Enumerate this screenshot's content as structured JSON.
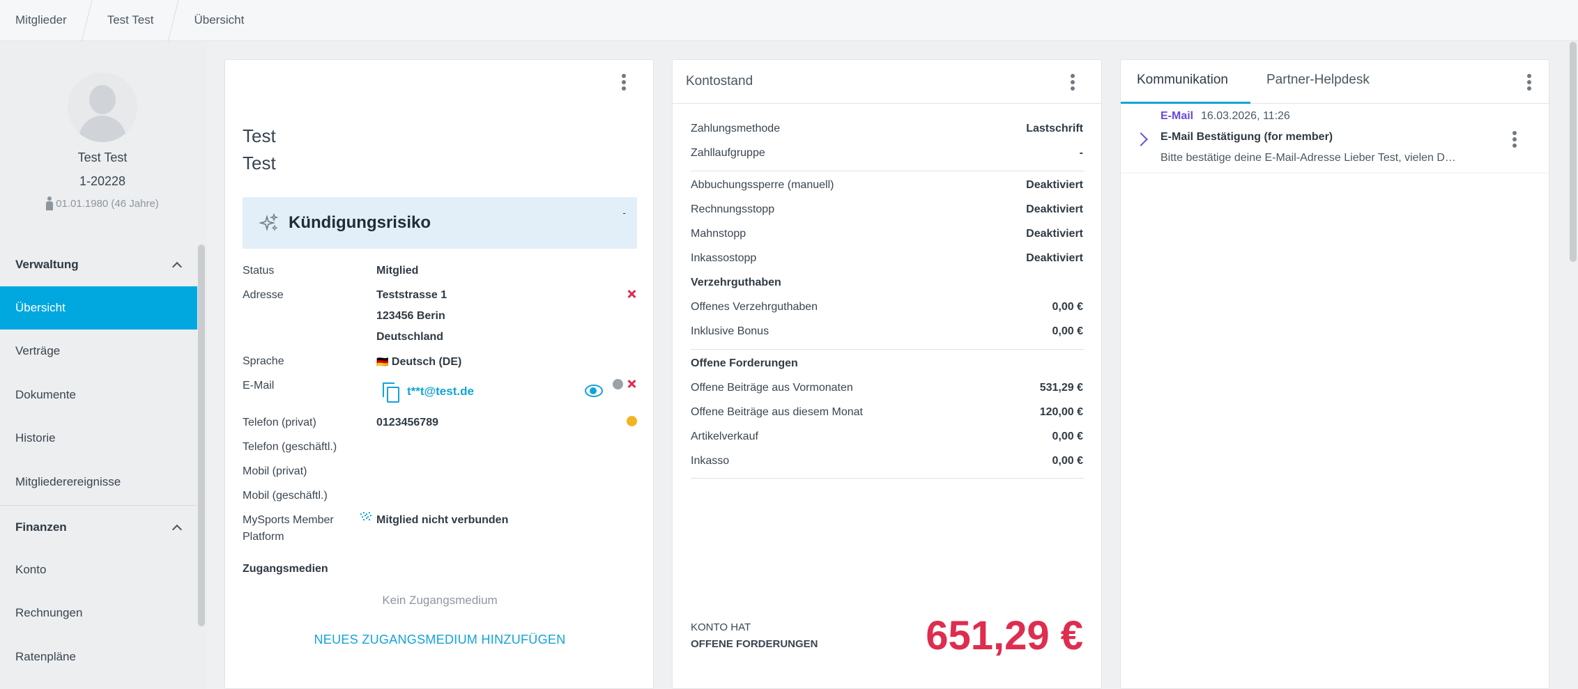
{
  "breadcrumb": [
    "Mitglieder",
    "Test Test",
    "Übersicht"
  ],
  "profile": {
    "name": "Test Test",
    "number": "1-20228",
    "dob": "01.01.1980 (46 Jahre)"
  },
  "sidebar": {
    "sections": [
      {
        "label": "Verwaltung",
        "items": [
          "Übersicht",
          "Verträge",
          "Dokumente",
          "Historie",
          "Mitgliederereignisse"
        ]
      },
      {
        "label": "Finanzen",
        "items": [
          "Konto",
          "Rechnungen",
          "Ratenpläne"
        ]
      }
    ],
    "active": "Übersicht"
  },
  "member_card": {
    "first_name": "Test",
    "last_name": "Test",
    "risk_title": "Kündigungsrisiko",
    "risk_value": "-",
    "rows": {
      "status_label": "Status",
      "status_value": "Mitglied",
      "address_label": "Adresse",
      "address_line1": "Teststrasse 1",
      "address_line2": "123456 Berin",
      "address_line3": "Deutschland",
      "language_label": "Sprache",
      "language_flag": "🇩🇪",
      "language_value": "Deutsch (DE)",
      "email_label": "E-Mail",
      "email_value": "t**t@test.de",
      "phone_private_label": "Telefon (privat)",
      "phone_private_value": "0123456789",
      "phone_business_label": "Telefon (geschäftl.)",
      "mobile_private_label": "Mobil (privat)",
      "mobile_business_label": "Mobil (geschäftl.)",
      "mysports_label_1": "MySports Member",
      "mysports_label_2": "Platform",
      "mysports_value": "Mitglied nicht verbunden"
    },
    "access_title": "Zugangsmedien",
    "access_empty": "Kein Zugangsmedium",
    "access_add": "NEUES ZUGANGSMEDIUM HINZUFÜGEN"
  },
  "account_card": {
    "title": "Kontostand",
    "group1": [
      {
        "label": "Zahlungsmethode",
        "value": "Lastschrift"
      },
      {
        "label": "Zahllaufgruppe",
        "value": "-"
      }
    ],
    "group2": [
      {
        "label": "Abbuchungssperre (manuell)",
        "value": "Deaktiviert"
      },
      {
        "label": "Rechnungsstopp",
        "value": "Deaktiviert"
      },
      {
        "label": "Mahnstopp",
        "value": "Deaktiviert"
      },
      {
        "label": "Inkassostopp",
        "value": "Deaktiviert"
      }
    ],
    "group3_title": "Verzehrguthaben",
    "group3": [
      {
        "label": "Offenes Verzehrguthaben",
        "value": "0,00 €"
      },
      {
        "label": "Inklusive Bonus",
        "value": "0,00 €"
      }
    ],
    "group4_title": "Offene Forderungen",
    "group4": [
      {
        "label": "Offene Beiträge aus Vormonaten",
        "value": "531,29 €"
      },
      {
        "label": "Offene Beiträge aus diesem Monat",
        "value": "120,00 €"
      },
      {
        "label": "Artikelverkauf",
        "value": "0,00 €"
      },
      {
        "label": "Inkasso",
        "value": "0,00 €"
      }
    ],
    "summary_line1": "KONTO HAT",
    "summary_line2": "OFFENE FORDERUNGEN",
    "summary_amount": "651,29 €"
  },
  "comm_card": {
    "tabs": [
      "Kommunikation",
      "Partner-Helpdesk"
    ],
    "active_tab": "Kommunikation",
    "items": [
      {
        "type": "E-Mail",
        "date": "16.03.2026, 11:26",
        "subject": "E-Mail Bestätigung (for member)",
        "preview": "Bitte bestätige deine E-Mail-Adresse Lieber Test, vielen D…"
      }
    ]
  },
  "colors": {
    "accent": "#00a8df",
    "danger": "#e02a4f",
    "amount": "#de2d4f",
    "email_type": "#6a4bd6",
    "status_grey": "#9aa1a7",
    "status_yellow": "#f2b51f"
  }
}
